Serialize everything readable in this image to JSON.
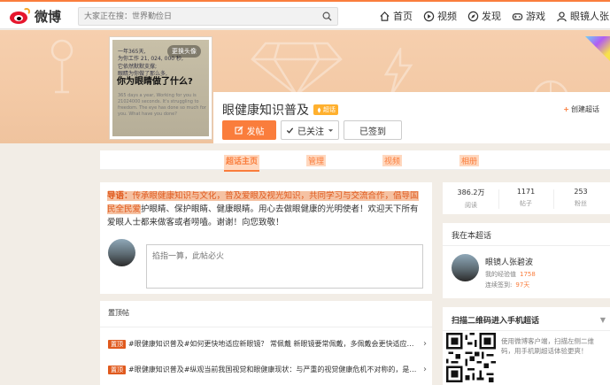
{
  "topnav": {
    "logo_text": "微博",
    "search_placeholder": "大家正在搜：世界勤俭日",
    "links": [
      {
        "label": "首页",
        "icon": "home-icon"
      },
      {
        "label": "视频",
        "icon": "video-icon"
      },
      {
        "label": "发现",
        "icon": "discover-icon"
      },
      {
        "label": "游戏",
        "icon": "game-icon"
      },
      {
        "label": "眼镜人张",
        "icon": "user-icon"
      }
    ]
  },
  "avatar": {
    "change_label": "更换头像",
    "line1": "一年365天,",
    "line2": "为你工作 21, 024, 000 秒,",
    "line3": "它依然默默支撑;",
    "line4": "眼睛为你做了那么多,",
    "headline": "你为眼睛做了什么?",
    "small": "365 days a year, Working for you is 21024000 seconds. It's struggling to freedom. The eye has done so much for you. What have you done?"
  },
  "profile": {
    "title": "眼健康知识普及",
    "badge": "超话",
    "create_label": "创建超话",
    "post_label": "发帖",
    "follow_label": "已关注",
    "sign_label": "已签到"
  },
  "tabs": [
    {
      "label": "超话主页",
      "active": true
    },
    {
      "label": "管理",
      "active": false
    },
    {
      "label": "视频",
      "active": false
    },
    {
      "label": "相册",
      "active": false
    }
  ],
  "intro": {
    "label": "导语：",
    "highlight": "传承眼健康知识与文化，普及爱眼及视光知识，共同学习与交流合作，倡导国民全民爱",
    "rest": "护眼睛、保护眼睛、健康眼睛。用心去做眼健康的光明使者！欢迎天下所有爱眼人士都来做客或者唠嗑。谢谢！向您致敬！"
  },
  "composer": {
    "placeholder": "掐指一算，此帖必火"
  },
  "pinned": {
    "heading": "置顶帖",
    "items": [
      {
        "tag": "置顶",
        "text": "#眼健康知识普及#如何更快地适应新眼镜？ 常佩戴 新眼镜要常佩戴，多佩戴会更快适应…"
      },
      {
        "tag": "置顶",
        "text": "#眼健康知识普及#纵观当前我国视觉和眼健康现状：与严重的视觉健康危机不对称的，是…"
      }
    ]
  },
  "stats": [
    {
      "num": "386.2万",
      "label": "阅读"
    },
    {
      "num": "1171",
      "label": "帖子"
    },
    {
      "num": "253",
      "label": "粉丝"
    }
  ],
  "me": {
    "heading": "我在本超话",
    "name": "眼镜人张碧波",
    "exp_label": "我的经验值",
    "exp_value": "1758",
    "sign_label": "连续签到:",
    "sign_value": "97天"
  },
  "qr": {
    "heading": "扫描二维码进入手机超话",
    "text": "使用微博客户端，扫描左侧二维码，用手机刷超话体验更爽！",
    "close": "▼"
  },
  "colors": {
    "accent": "#fa7d3c",
    "brand_red": "#e6162d"
  }
}
